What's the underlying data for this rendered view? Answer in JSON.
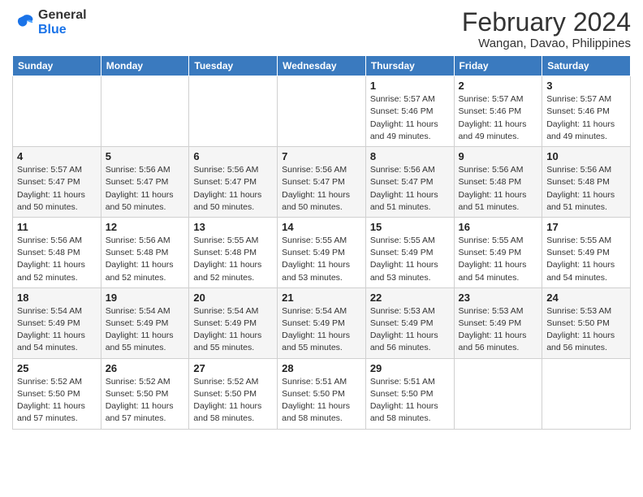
{
  "logo": {
    "line1": "General",
    "line2": "Blue"
  },
  "title": "February 2024",
  "subtitle": "Wangan, Davao, Philippines",
  "days_header": [
    "Sunday",
    "Monday",
    "Tuesday",
    "Wednesday",
    "Thursday",
    "Friday",
    "Saturday"
  ],
  "weeks": [
    [
      {
        "day": "",
        "info": ""
      },
      {
        "day": "",
        "info": ""
      },
      {
        "day": "",
        "info": ""
      },
      {
        "day": "",
        "info": ""
      },
      {
        "day": "1",
        "info": "Sunrise: 5:57 AM\nSunset: 5:46 PM\nDaylight: 11 hours\nand 49 minutes."
      },
      {
        "day": "2",
        "info": "Sunrise: 5:57 AM\nSunset: 5:46 PM\nDaylight: 11 hours\nand 49 minutes."
      },
      {
        "day": "3",
        "info": "Sunrise: 5:57 AM\nSunset: 5:46 PM\nDaylight: 11 hours\nand 49 minutes."
      }
    ],
    [
      {
        "day": "4",
        "info": "Sunrise: 5:57 AM\nSunset: 5:47 PM\nDaylight: 11 hours\nand 50 minutes."
      },
      {
        "day": "5",
        "info": "Sunrise: 5:56 AM\nSunset: 5:47 PM\nDaylight: 11 hours\nand 50 minutes."
      },
      {
        "day": "6",
        "info": "Sunrise: 5:56 AM\nSunset: 5:47 PM\nDaylight: 11 hours\nand 50 minutes."
      },
      {
        "day": "7",
        "info": "Sunrise: 5:56 AM\nSunset: 5:47 PM\nDaylight: 11 hours\nand 50 minutes."
      },
      {
        "day": "8",
        "info": "Sunrise: 5:56 AM\nSunset: 5:47 PM\nDaylight: 11 hours\nand 51 minutes."
      },
      {
        "day": "9",
        "info": "Sunrise: 5:56 AM\nSunset: 5:48 PM\nDaylight: 11 hours\nand 51 minutes."
      },
      {
        "day": "10",
        "info": "Sunrise: 5:56 AM\nSunset: 5:48 PM\nDaylight: 11 hours\nand 51 minutes."
      }
    ],
    [
      {
        "day": "11",
        "info": "Sunrise: 5:56 AM\nSunset: 5:48 PM\nDaylight: 11 hours\nand 52 minutes."
      },
      {
        "day": "12",
        "info": "Sunrise: 5:56 AM\nSunset: 5:48 PM\nDaylight: 11 hours\nand 52 minutes."
      },
      {
        "day": "13",
        "info": "Sunrise: 5:55 AM\nSunset: 5:48 PM\nDaylight: 11 hours\nand 52 minutes."
      },
      {
        "day": "14",
        "info": "Sunrise: 5:55 AM\nSunset: 5:49 PM\nDaylight: 11 hours\nand 53 minutes."
      },
      {
        "day": "15",
        "info": "Sunrise: 5:55 AM\nSunset: 5:49 PM\nDaylight: 11 hours\nand 53 minutes."
      },
      {
        "day": "16",
        "info": "Sunrise: 5:55 AM\nSunset: 5:49 PM\nDaylight: 11 hours\nand 54 minutes."
      },
      {
        "day": "17",
        "info": "Sunrise: 5:55 AM\nSunset: 5:49 PM\nDaylight: 11 hours\nand 54 minutes."
      }
    ],
    [
      {
        "day": "18",
        "info": "Sunrise: 5:54 AM\nSunset: 5:49 PM\nDaylight: 11 hours\nand 54 minutes."
      },
      {
        "day": "19",
        "info": "Sunrise: 5:54 AM\nSunset: 5:49 PM\nDaylight: 11 hours\nand 55 minutes."
      },
      {
        "day": "20",
        "info": "Sunrise: 5:54 AM\nSunset: 5:49 PM\nDaylight: 11 hours\nand 55 minutes."
      },
      {
        "day": "21",
        "info": "Sunrise: 5:54 AM\nSunset: 5:49 PM\nDaylight: 11 hours\nand 55 minutes."
      },
      {
        "day": "22",
        "info": "Sunrise: 5:53 AM\nSunset: 5:49 PM\nDaylight: 11 hours\nand 56 minutes."
      },
      {
        "day": "23",
        "info": "Sunrise: 5:53 AM\nSunset: 5:49 PM\nDaylight: 11 hours\nand 56 minutes."
      },
      {
        "day": "24",
        "info": "Sunrise: 5:53 AM\nSunset: 5:50 PM\nDaylight: 11 hours\nand 56 minutes."
      }
    ],
    [
      {
        "day": "25",
        "info": "Sunrise: 5:52 AM\nSunset: 5:50 PM\nDaylight: 11 hours\nand 57 minutes."
      },
      {
        "day": "26",
        "info": "Sunrise: 5:52 AM\nSunset: 5:50 PM\nDaylight: 11 hours\nand 57 minutes."
      },
      {
        "day": "27",
        "info": "Sunrise: 5:52 AM\nSunset: 5:50 PM\nDaylight: 11 hours\nand 58 minutes."
      },
      {
        "day": "28",
        "info": "Sunrise: 5:51 AM\nSunset: 5:50 PM\nDaylight: 11 hours\nand 58 minutes."
      },
      {
        "day": "29",
        "info": "Sunrise: 5:51 AM\nSunset: 5:50 PM\nDaylight: 11 hours\nand 58 minutes."
      },
      {
        "day": "",
        "info": ""
      },
      {
        "day": "",
        "info": ""
      }
    ]
  ]
}
